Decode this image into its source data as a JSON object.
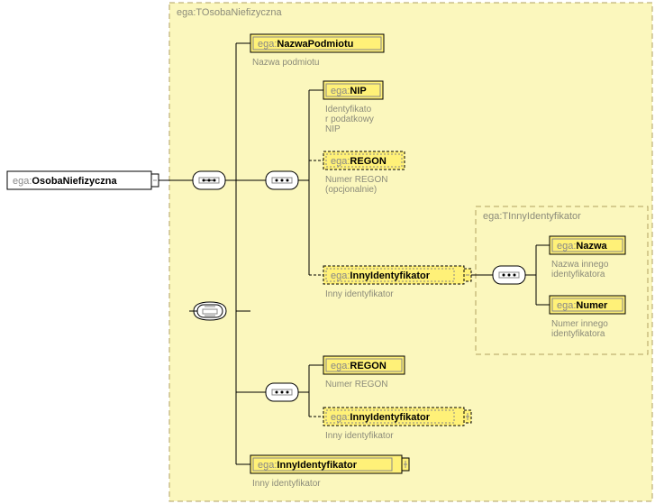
{
  "root": {
    "prefix": "ega:",
    "name": "OsobaNiefizyczna"
  },
  "group_outer": {
    "title": "ega:TOsobaNiefizyczna"
  },
  "nazwa_podmiotu": {
    "prefix": "ega:",
    "name": "NazwaPodmiotu",
    "desc": "Nazwa podmiotu"
  },
  "nip": {
    "prefix": "ega:",
    "name": "NIP",
    "desc1": "Identyfikato",
    "desc2": "r podatkowy",
    "desc3": "NIP"
  },
  "regon_opt": {
    "prefix": "ega:",
    "name": "REGON",
    "desc1": "Numer REGON",
    "desc2": "(opcjonalnie)"
  },
  "inny_mid": {
    "prefix": "ega:",
    "name": "InnyIdentyfikator",
    "desc": "Inny identyfikator"
  },
  "group_inner": {
    "title": "ega:TInnyIdentyfikator"
  },
  "nazwa": {
    "prefix": "ega:",
    "name": "Nazwa",
    "desc1": "Nazwa innego",
    "desc2": "identyfikatora"
  },
  "numer": {
    "prefix": "ega:",
    "name": "Numer",
    "desc1": "Numer innego",
    "desc2": "identyfikatora"
  },
  "regon2": {
    "prefix": "ega:",
    "name": "REGON",
    "desc": "Numer REGON"
  },
  "inny2": {
    "prefix": "ega:",
    "name": "InnyIdentyfikator",
    "desc": "Inny identyfikator"
  },
  "inny_bottom": {
    "prefix": "ega:",
    "name": "InnyIdentyfikator",
    "desc": "Inny identyfikator"
  }
}
